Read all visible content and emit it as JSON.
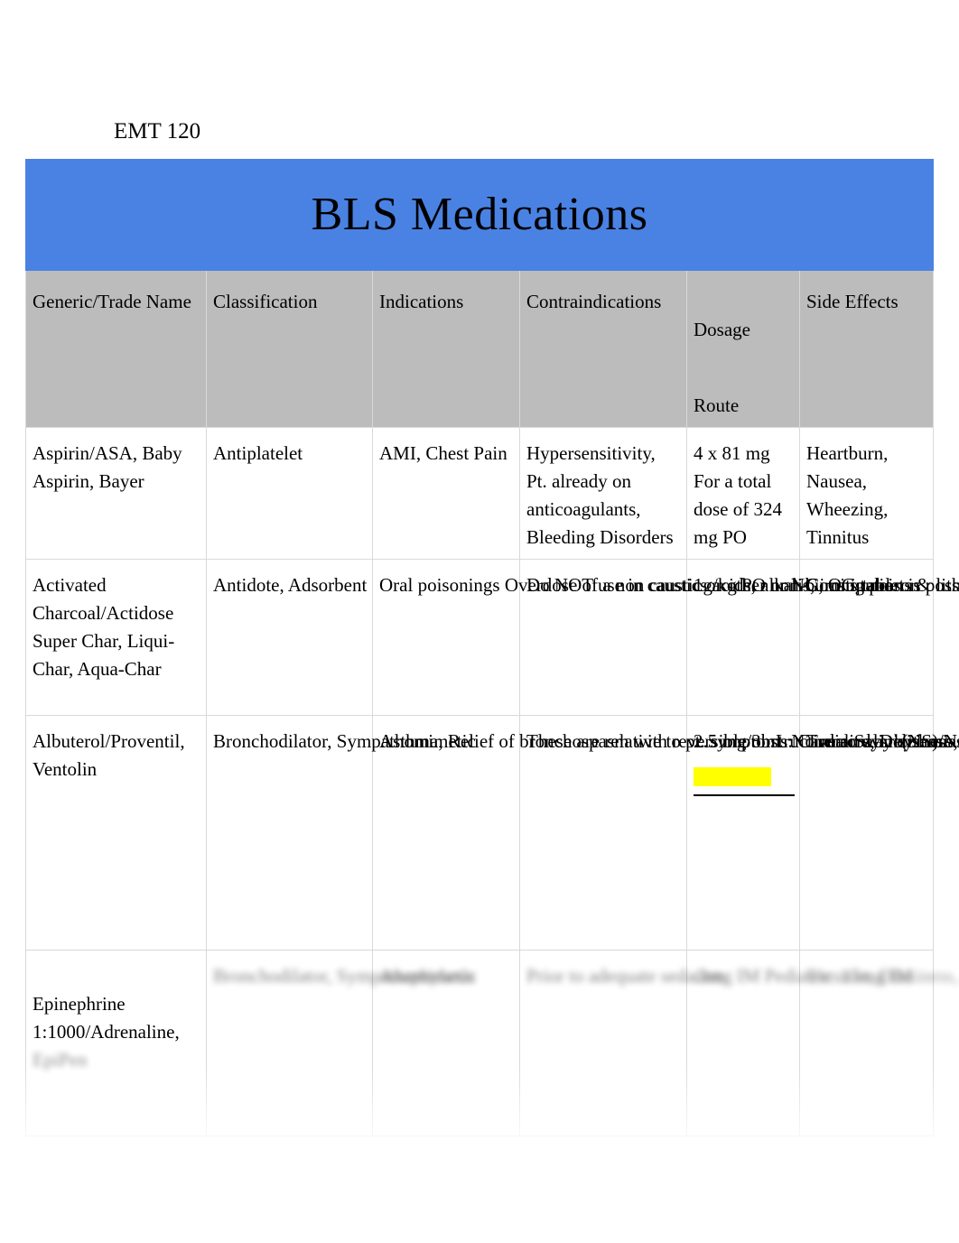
{
  "document": {
    "course_label": "EMT 120",
    "title": "BLS Medications",
    "title_bar_color": "#4a82e3",
    "header_row_color": "#bcbcbc",
    "highlight_color": "#ffff00"
  },
  "table": {
    "columns": [
      "Generic/Trade Name",
      "Classification",
      "Indications",
      "Contraindications",
      "Dosage",
      "Side Effects"
    ],
    "dosage_second_line": "Route",
    "rows": [
      {
        "name": "Aspirin/ASA, Baby Aspirin, Bayer",
        "classification": "Antiplatelet",
        "indications": "AMI, Chest Pain",
        "contraindications": "Hypersensitivity, Pt. already on anticoagulants, Bleeding Disorders",
        "dosage": "4 x 81 mg\nFor a total\ndose of 324\nmg PO",
        "side_effects": "Heartburn,\nNausea,\nWheezing,\nTinnitus"
      },
      {
        "name": "Activated Charcoal/Actidose Super Char, Liqui-Char, Aqua-Char",
        "classification": "Antidote, Adsorbent",
        "indications": "Oral poisonings\nOverdose of a non\ncaustic or other\nnon-burning poison",
        "contraindications": "Do NOT use in caustics\nacids, alkalis, irons\ntablets & lithium.\nThere is NO value for\nthe ETOH OD pt",
        "dosage": "1g/kg PO or\nNG, OG tube",
        "side_effects": "Constipation is\npossible,\nvomiting due to\npt. intolerance"
      },
      {
        "name": "Albuterol/Proventil, Ventolin",
        "classification": "Bronchodilator,\nSympathomimetic",
        "indications": "Asthma, Relief of\nbronchospasm with\nreversible\nobstructive airway\ndisease",
        "contraindications": "These are relative to\npt. symptoms:\nCardiac\ndysrhythmias,\nAngina, HTN,\ndiabetes",
        "dosage": "2.5 mg/3mL\nNormal\nSaline(NS)/Ne\nbulizer or MDI\nRegion 4\nSOG",
        "dosage_highlight_blank": true,
        "side_effects": "Tremors,\nDizziness,\nAnxiety,\nPalpitations,\nTachycardia"
      },
      {
        "name": "Epinephrine 1:1000/Adrenaline,",
        "name_faded_line": "EpiPen",
        "classification": "Bronchodilator,\nSympathomimetic",
        "indications": "Anaphylaxis",
        "contraindications": "Prior to adequate\nsedation",
        "dosage": ".3mg IM\nPediatric\n.15mg IM",
        "side_effects": "Tremors,\nDizziness,\nAnxiety,\nPalpitations,\nTachycardia,\nHeadache,\nPallor"
      }
    ]
  }
}
